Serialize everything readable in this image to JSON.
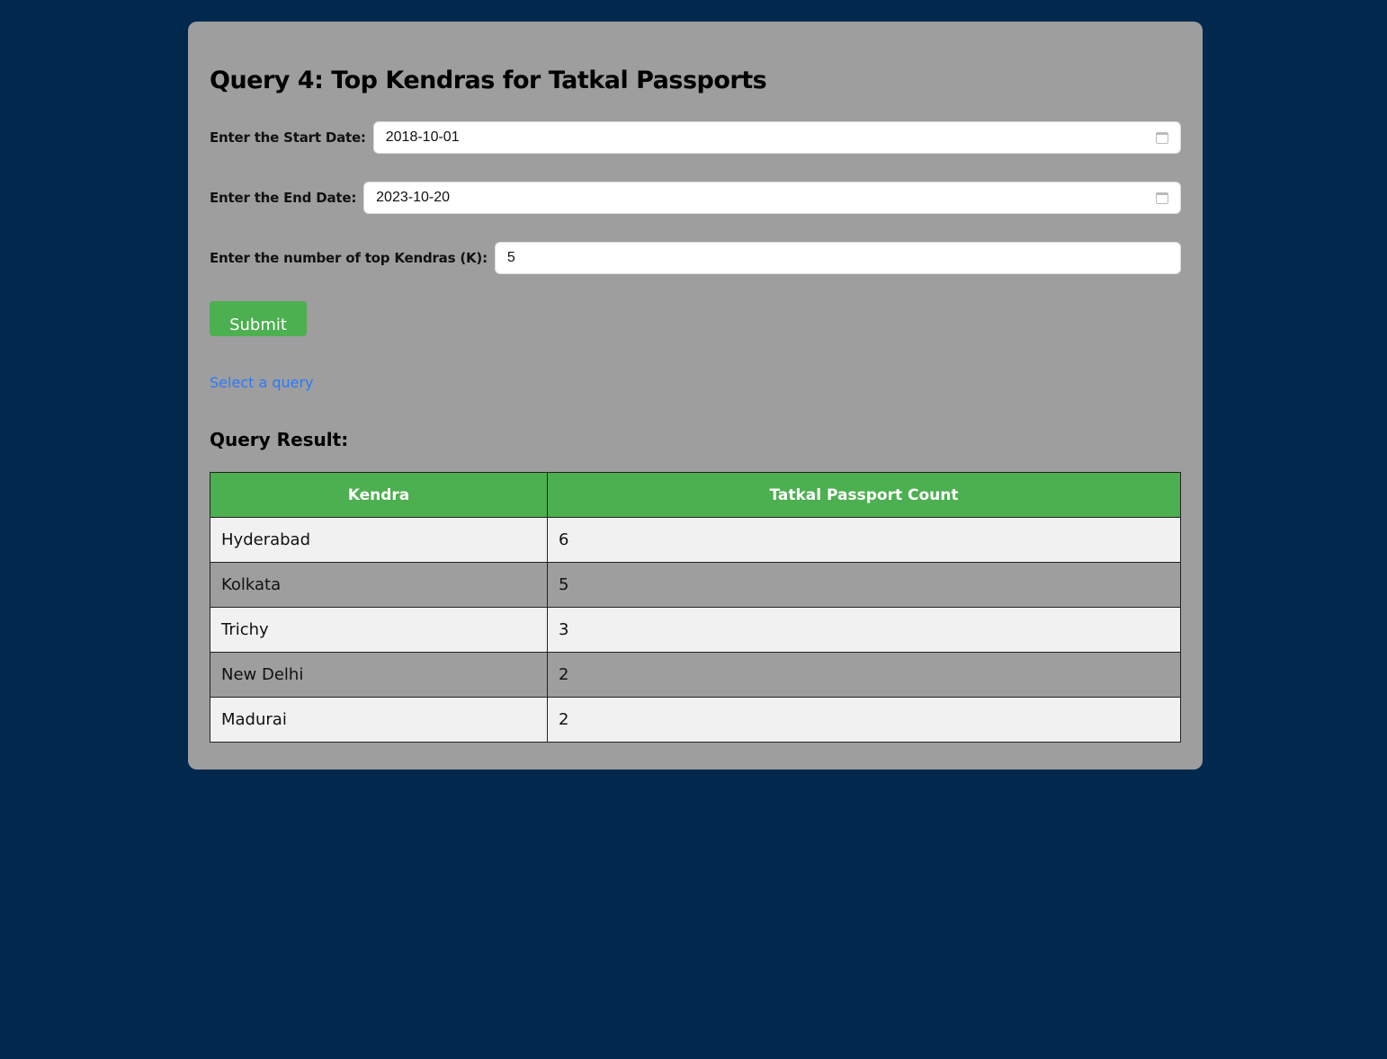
{
  "title": "Query 4: Top Kendras for Tatkal Passports",
  "form": {
    "start_date": {
      "label": "Enter the Start Date:",
      "value": "2018-10-01"
    },
    "end_date": {
      "label": "Enter the End Date:",
      "value": "2023-10-20"
    },
    "top_k": {
      "label": "Enter the number of top Kendras (K):",
      "value": "5"
    },
    "submit_label": "Submit"
  },
  "link_label": "Select a query",
  "result": {
    "title": "Query Result:",
    "columns": [
      "Kendra",
      "Tatkal Passport Count"
    ],
    "rows": [
      [
        "Hyderabad",
        "6"
      ],
      [
        "Kolkata",
        "5"
      ],
      [
        "Trichy",
        "3"
      ],
      [
        "New Delhi",
        "2"
      ],
      [
        "Madurai",
        "2"
      ]
    ]
  },
  "colors": {
    "background": "#00294d",
    "card": "#9e9e9e",
    "accent": "#4caf50",
    "link": "#2979ff"
  }
}
